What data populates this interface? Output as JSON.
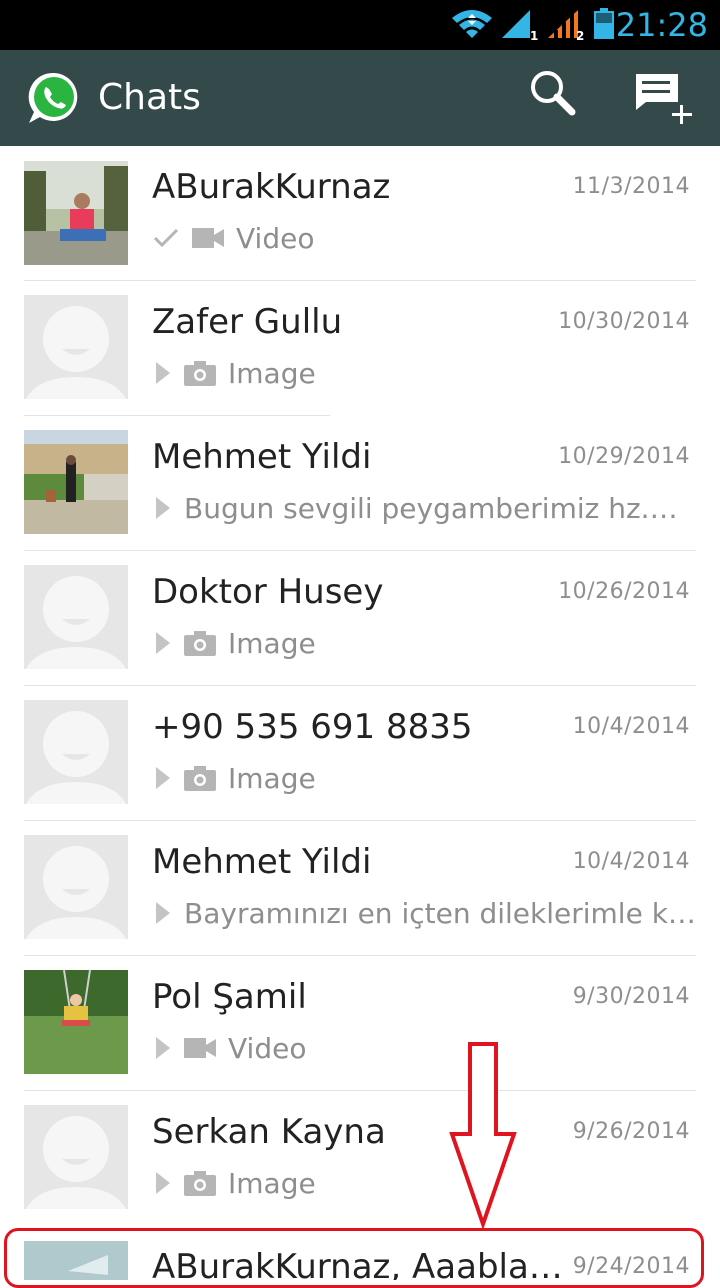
{
  "status_bar": {
    "time": "21:28",
    "icons": [
      "wifi-icon",
      "signal-sim1-icon",
      "signal-sim2-icon",
      "battery-icon"
    ],
    "time_color": "#33b5e5"
  },
  "app_bar": {
    "title": "Chats",
    "background": "#34494a",
    "actions": [
      "search-icon",
      "new-chat-icon"
    ]
  },
  "chats": [
    {
      "name": "ABurakKurnaz",
      "date": "11/3/2014",
      "preview_type": "video",
      "preview_text": "Video",
      "status": "check-icon",
      "avatar": "photo-person-sitting"
    },
    {
      "name": "Zafer Gullu",
      "date": "10/30/2014",
      "preview_type": "image",
      "preview_text": "Image",
      "status": "play-icon",
      "avatar": "default-avatar"
    },
    {
      "name": "Mehmet Yildi",
      "date": "10/29/2014",
      "preview_type": "text",
      "preview_text": "Bugun sevgili peygamberimiz hz.…",
      "status": "play-icon",
      "avatar": "photo-person-courtyard"
    },
    {
      "name": "Doktor Husey",
      "date": "10/26/2014",
      "preview_type": "image",
      "preview_text": "Image",
      "status": "play-icon",
      "avatar": "default-avatar"
    },
    {
      "name": "+90 535 691 8835",
      "date": "10/4/2014",
      "preview_type": "image",
      "preview_text": "Image",
      "status": "play-icon",
      "avatar": "default-avatar"
    },
    {
      "name": "Mehmet Yildi",
      "date": "10/4/2014",
      "preview_type": "text",
      "preview_text": "Bayramınızı en içten dileklerimle k…",
      "status": "play-icon",
      "avatar": "default-avatar"
    },
    {
      "name": "Pol Şamil",
      "date": "9/30/2014",
      "preview_type": "video",
      "preview_text": "Video",
      "status": "play-icon",
      "avatar": "photo-child-swing"
    },
    {
      "name": "Serkan Kayna",
      "date": "9/26/2014",
      "preview_type": "image",
      "preview_text": "Image",
      "status": "play-icon",
      "avatar": "default-avatar"
    },
    {
      "name": "ABurakKurnaz, Aaabla…",
      "date": "9/24/2014",
      "preview_type": "",
      "preview_text": "",
      "status": "",
      "avatar": "group-avatar"
    }
  ],
  "annotation": {
    "type": "arrow-and-box",
    "color": "#e0141e",
    "target": "last chat row"
  }
}
